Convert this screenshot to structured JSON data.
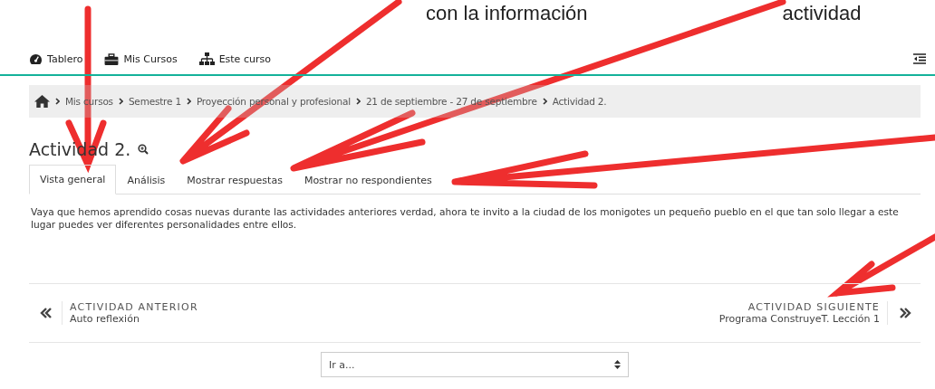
{
  "annotations": [
    {
      "text": "con la información"
    },
    {
      "text": "actividad"
    }
  ],
  "navbar": {
    "items": [
      {
        "label": "Tablero",
        "kind": "gauge"
      },
      {
        "label": "Mis Cursos",
        "kind": "briefcase"
      },
      {
        "label": "Este curso",
        "kind": "sitemap"
      }
    ]
  },
  "breadcrumb": [
    "Mis cursos",
    "Semestre 1",
    "Proyección personal y profesional",
    "21 de septiembre - 27 de septiembre",
    "Actividad 2."
  ],
  "page_title": "Actividad 2.",
  "tabs": [
    {
      "label": "Vista general",
      "selected": true
    },
    {
      "label": "Análisis",
      "selected": false
    },
    {
      "label": "Mostrar respuestas",
      "selected": false
    },
    {
      "label": "Mostrar no respondientes",
      "selected": false
    }
  ],
  "description": "Vaya que hemos aprendido cosas nuevas durante las actividades anteriores verdad, ahora te invito a la ciudad de los monigotes un pequeño pueblo en el que tan solo llegar a este lugar puedes ver diferentes personalidades entre ellos.",
  "previous_activity": {
    "heading": "ACTIVIDAD ANTERIOR",
    "title": "Auto reflexión"
  },
  "next_activity": {
    "heading": "ACTIVIDAD SIGUIENTE",
    "title": "Programa ConstruyeT. Lección 1"
  },
  "jump_select": {
    "value": "Ir a..."
  }
}
